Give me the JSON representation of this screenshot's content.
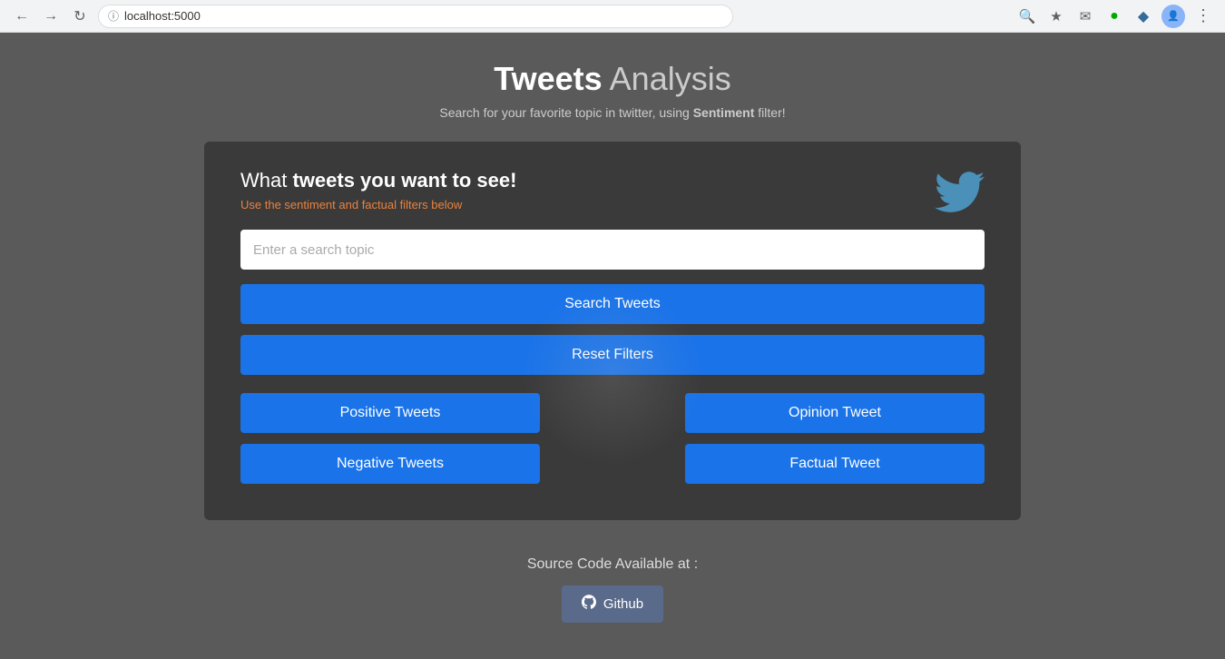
{
  "browser": {
    "url": "localhost:5000",
    "nav": {
      "back": "←",
      "forward": "→",
      "reload": "↻"
    }
  },
  "page": {
    "title_bold": "Tweets",
    "title_thin": " Analysis",
    "subtitle_before": "Search for your favorite topic in twitter, using ",
    "subtitle_bold": "Sentiment",
    "subtitle_after": " filter!",
    "card": {
      "title_before": "What ",
      "title_bold": "tweets you want to see!",
      "subtitle": "Use the sentiment and factual filters below",
      "search_placeholder": "Enter a search topic",
      "btn_search": "Search Tweets",
      "btn_reset": "Reset Filters",
      "btn_positive": "Positive Tweets",
      "btn_negative": "Negative Tweets",
      "btn_opinion": "Opinion Tweet",
      "btn_factual": "Factual Tweet"
    }
  },
  "footer": {
    "text": "Source Code Available at :",
    "github_label": "Github"
  }
}
